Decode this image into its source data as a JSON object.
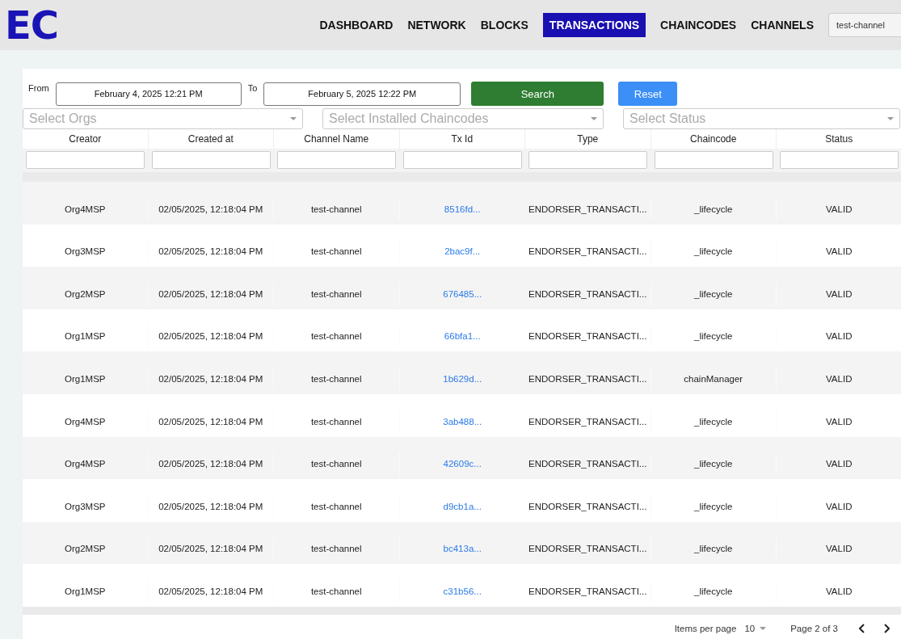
{
  "logo": "EC",
  "nav": [
    {
      "label": "DASHBOARD",
      "selected": false
    },
    {
      "label": "NETWORK",
      "selected": false
    },
    {
      "label": "BLOCKS",
      "selected": false
    },
    {
      "label": "TRANSACTIONS",
      "selected": true
    },
    {
      "label": "CHAINCODES",
      "selected": false
    },
    {
      "label": "CHANNELS",
      "selected": false
    }
  ],
  "channel_select": {
    "value": "test-channel"
  },
  "filters": {
    "from_label": "From",
    "from_value": "February 4, 2025 12:21 PM",
    "to_label": "To",
    "to_value": "February 5, 2025 12:22 PM",
    "search_button": "Search",
    "reset_button": "Reset",
    "selects": [
      {
        "placeholder": "Select Orgs"
      },
      {
        "placeholder": "Select Installed Chaincodes"
      },
      {
        "placeholder": "Select Status"
      }
    ]
  },
  "table": {
    "columns": [
      "Creator",
      "Created at",
      "Channel Name",
      "Tx Id",
      "Type",
      "Chaincode",
      "Status"
    ],
    "rows": [
      {
        "creator": "Org4MSP",
        "created_at": "02/05/2025, 12:18:04 PM",
        "channel": "test-channel",
        "tx_id": "8516fd...",
        "type": "ENDORSER_TRANSACTI...",
        "chaincode": "_lifecycle",
        "status": "VALID"
      },
      {
        "creator": "Org3MSP",
        "created_at": "02/05/2025, 12:18:04 PM",
        "channel": "test-channel",
        "tx_id": "2bac9f...",
        "type": "ENDORSER_TRANSACTI...",
        "chaincode": "_lifecycle",
        "status": "VALID"
      },
      {
        "creator": "Org2MSP",
        "created_at": "02/05/2025, 12:18:04 PM",
        "channel": "test-channel",
        "tx_id": "676485...",
        "type": "ENDORSER_TRANSACTI...",
        "chaincode": "_lifecycle",
        "status": "VALID"
      },
      {
        "creator": "Org1MSP",
        "created_at": "02/05/2025, 12:18:04 PM",
        "channel": "test-channel",
        "tx_id": "66bfa1...",
        "type": "ENDORSER_TRANSACTI...",
        "chaincode": "_lifecycle",
        "status": "VALID"
      },
      {
        "creator": "Org1MSP",
        "created_at": "02/05/2025, 12:18:04 PM",
        "channel": "test-channel",
        "tx_id": "1b629d...",
        "type": "ENDORSER_TRANSACTI...",
        "chaincode": "chainManager",
        "status": "VALID"
      },
      {
        "creator": "Org4MSP",
        "created_at": "02/05/2025, 12:18:04 PM",
        "channel": "test-channel",
        "tx_id": "3ab488...",
        "type": "ENDORSER_TRANSACTI...",
        "chaincode": "_lifecycle",
        "status": "VALID"
      },
      {
        "creator": "Org4MSP",
        "created_at": "02/05/2025, 12:18:04 PM",
        "channel": "test-channel",
        "tx_id": "42609c...",
        "type": "ENDORSER_TRANSACTI...",
        "chaincode": "_lifecycle",
        "status": "VALID"
      },
      {
        "creator": "Org3MSP",
        "created_at": "02/05/2025, 12:18:04 PM",
        "channel": "test-channel",
        "tx_id": "d9cb1a...",
        "type": "ENDORSER_TRANSACTI...",
        "chaincode": "_lifecycle",
        "status": "VALID"
      },
      {
        "creator": "Org2MSP",
        "created_at": "02/05/2025, 12:18:04 PM",
        "channel": "test-channel",
        "tx_id": "bc413a...",
        "type": "ENDORSER_TRANSACTI...",
        "chaincode": "_lifecycle",
        "status": "VALID"
      },
      {
        "creator": "Org1MSP",
        "created_at": "02/05/2025, 12:18:04 PM",
        "channel": "test-channel",
        "tx_id": "c31b56...",
        "type": "ENDORSER_TRANSACTI...",
        "chaincode": "_lifecycle",
        "status": "VALID"
      }
    ]
  },
  "pagination": {
    "items_label": "Items per page",
    "page_size": "10",
    "page_info": "Page 2 of 3"
  }
}
